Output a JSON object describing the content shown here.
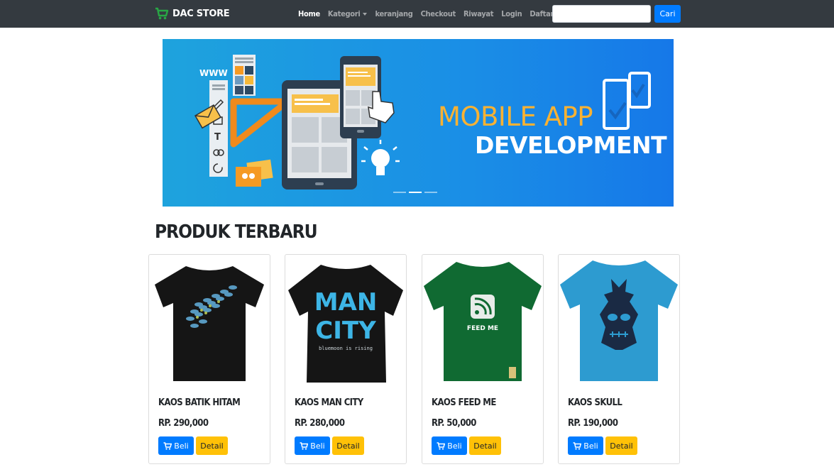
{
  "navbar": {
    "brand": "DAC STORE",
    "links": [
      {
        "label": "Home",
        "active": true
      },
      {
        "label": "Kategori",
        "dropdown": true
      },
      {
        "label": "keranjang"
      },
      {
        "label": "Checkout"
      },
      {
        "label": "Riwayat"
      },
      {
        "label": "Login"
      },
      {
        "label": "Daftar"
      }
    ],
    "search": {
      "placeholder": "",
      "value": "",
      "button_label": "Cari"
    }
  },
  "carousel": {
    "line1": "MOBILE APP",
    "line2": "DEVELOPMENT",
    "www_label": "WWW",
    "slides": 3,
    "active_slide": 1
  },
  "section": {
    "title": "PRODUK TERBARU"
  },
  "products": [
    {
      "name": "KAOS BATIK HITAM",
      "price": "RP. 290,000",
      "shirt_color": "#151515",
      "print": "batik"
    },
    {
      "name": "KAOS MAN CITY",
      "price": "RP. 280,000",
      "shirt_color": "#151515",
      "print": "mancity",
      "print_text": [
        "MAN",
        "CITY",
        "bluemoon is rising"
      ]
    },
    {
      "name": "KAOS FEED ME",
      "price": "RP. 50,000",
      "shirt_color": "#106a32",
      "print": "feedme",
      "print_text": [
        "FEED ME"
      ]
    },
    {
      "name": "KAOS SKULL",
      "price": "RP. 190,000",
      "shirt_color": "#2d9bd0",
      "print": "skull"
    }
  ],
  "buttons": {
    "buy_label": "Beli",
    "detail_label": "Detail"
  },
  "colors": {
    "navbar": "#343a40",
    "primary": "#007bff",
    "warning": "#ffc107",
    "brand_icon": "#28a745",
    "banner_accent": "#f9b233"
  }
}
